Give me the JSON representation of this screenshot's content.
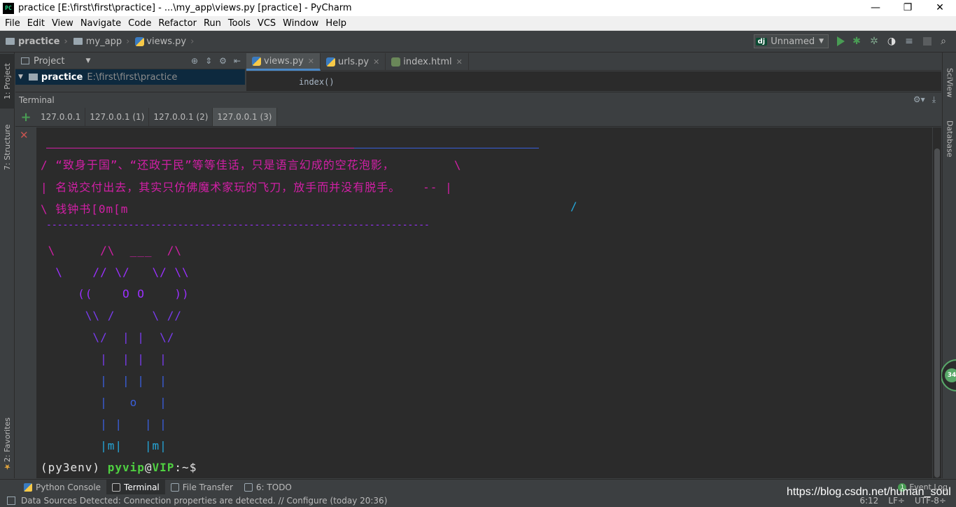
{
  "window": {
    "title": "practice [E:\\first\\first\\practice] - ...\\my_app\\views.py [practice] - PyCharm",
    "icon_label": "PC",
    "min": "—",
    "max": "❐",
    "close": "✕"
  },
  "menu": [
    "File",
    "Edit",
    "View",
    "Navigate",
    "Code",
    "Refactor",
    "Run",
    "Tools",
    "VCS",
    "Window",
    "Help"
  ],
  "breadcrumb": {
    "project": "practice",
    "folder": "my_app",
    "file": "views.py"
  },
  "run_config": {
    "badge": "dj",
    "name": "Unnamed"
  },
  "left_tools": {
    "project": "1: Project",
    "structure": "7: Structure",
    "favorites": "2: Favorites"
  },
  "right_tools": {
    "sciview": "SciView",
    "database": "Database",
    "badge": "34"
  },
  "project_pane": {
    "title": "Project",
    "root_name": "practice",
    "root_path": "E:\\first\\first\\practice"
  },
  "editor": {
    "tabs": [
      {
        "label": "views.py",
        "icon": "python-file-icon"
      },
      {
        "label": "urls.py",
        "icon": "python-file-icon"
      },
      {
        "label": "index.html",
        "icon": "html-file-icon"
      }
    ],
    "visible_code": "index()"
  },
  "terminal": {
    "title": "Terminal",
    "tabs": [
      "127.0.0.1",
      "127.0.0.1 (1)",
      "127.0.0.1 (2)",
      "127.0.0.1 (3)"
    ],
    "active_tab": 3,
    "lines": {
      "l1": "/ “致身于国”、“还政于民”等等佳话，只是语言幻成的空花泡影，        \\",
      "l2": "| 名说交付出去，其实只仿佛魔术家玩的飞刀，放手而并没有脱手。   -- |",
      "l3": "\\ 钱钟书[0m[m",
      "l3b": "/",
      "dash": "----------------------------------------------------------------------",
      "a1": " \\      /\\  ___  /\\",
      "a2": "  \\    // \\/   \\/ \\\\",
      "a3": "     ((    O O    ))",
      "a4": "      \\\\ /     \\ //",
      "a5": "       \\/  | |  \\/",
      "a6": "        |  | |  |",
      "a7": "        |  | |  |",
      "a8": "        |   o   |",
      "a9": "        | |   | |",
      "a10": "        |m|   |m|"
    },
    "prompt": {
      "env": "(py3env)",
      "user": "pyvip",
      "at": "@",
      "host": "VIP",
      "path": ":~$"
    }
  },
  "bottom_tools": [
    {
      "label": "Python Console"
    },
    {
      "label": "Terminal"
    },
    {
      "label": "File Transfer"
    },
    {
      "label": "6: TODO"
    }
  ],
  "event_log": {
    "count": "1",
    "label": "Event Log"
  },
  "status": {
    "message": "Data Sources Detected: Connection properties are detected. // Configure (today 20:36)",
    "position": "6:12",
    "line_sep": "LF÷",
    "encoding": "UTF-8÷"
  },
  "watermark": "https://blog.csdn.net/human_soul",
  "colors": {
    "accent": "#4a88c7",
    "run_green": "#499c54",
    "terminal_bg": "#2b2b2b",
    "banner_pink": "#d21fa6",
    "prompt_green": "#4fd141"
  }
}
